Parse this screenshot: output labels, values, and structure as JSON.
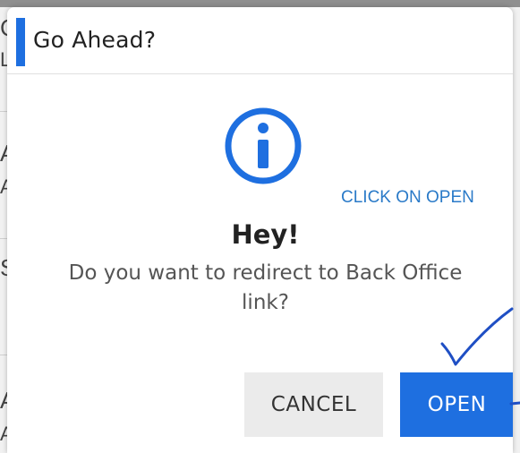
{
  "background": {
    "fragments": [
      "C",
      "L",
      "A",
      "AI",
      "S",
      "A",
      "A"
    ]
  },
  "dialog": {
    "title": "Go Ahead?",
    "icon": "info-circle-icon",
    "hint": "CLICK ON OPEN",
    "heading": "Hey!",
    "message_line1": "Do you want to redirect to Back Office",
    "message_line2": "link?",
    "cancel_label": "CANCEL",
    "open_label": "OPEN"
  },
  "colors": {
    "accent": "#1e6fe0",
    "hint_text": "#2a7ac8",
    "annotation_ink": "#1f4fc4"
  }
}
